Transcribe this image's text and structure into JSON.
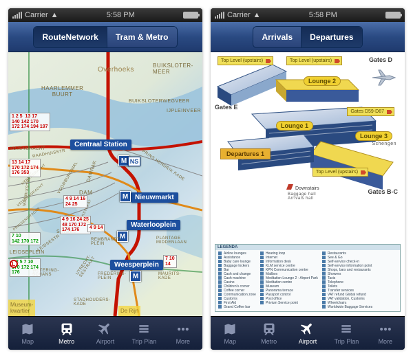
{
  "statusbar": {
    "carrier": "Carrier",
    "time": "5:58 PM",
    "wifi": "▲"
  },
  "left": {
    "nav": {
      "seg1": "RouteNetwork",
      "seg2": "Tram & Metro"
    },
    "tabs": {
      "map": "Map",
      "metro": "Metro",
      "airport": "Airport",
      "tripplan": "Trip Plan",
      "more": "More"
    },
    "stations": {
      "centraal": "Centraal Station",
      "nieuwmarkt": "Nieuwmarkt",
      "waterlooplein": "Waterlooplein",
      "weesperplein": "Weesperplein"
    },
    "metroBadge": "M",
    "areas": {
      "overhoeks": "Overhoeks",
      "haarlemmer": "HAARLEMMER\nBUURT",
      "buikslotermeer": "BUIKSLOTER-\nMEER",
      "buiksloterweg": "BUIKSLOTERWEGVEER",
      "ijpleinveer": "IJPLEINVEER",
      "damrak": "DAMRAK",
      "dam": "DAM",
      "voorburgwal": "VOORBURGWAL",
      "phk": "PRINS HENDRIK KADE",
      "singel": "SINGEL",
      "rembrandtpl": "REMBRANDT-\nPLEIN",
      "plantage": "PLANTAGE\nMIDDENLAAN",
      "frederiks": "FREDERIKS-\nPLEIN",
      "leidseplein": "LEIDSEPLEIN",
      "leidsestr": "LEIDSESTR",
      "weteringschans": "WETERING-\nSCHANS",
      "utrechtse": "UTRECHT-\nSESTRAAT",
      "mauritskade": "MAURITS-\nKADE",
      "stadhouderskade": "STADHOUDERS-\nKADE",
      "museumkwartier": "Museum-\nkwartier",
      "derijn": "De Rijn",
      "raadhuis": "RAADHUISSTR",
      "marnix": "MARNIXSTRAAT",
      "rozengr": "ROZENGRACHT",
      "kalverstr": "KALVERSTRAAT",
      "herengr": "HERENGRACHT",
      "keizersgr": "KEIZERSGRACHT",
      "prinsengr": "PRINSENGRACHT"
    },
    "lineBlocks": {
      "a": "1 2 5  13 17\n140 142 170\n172 174 194 197",
      "b": "13 14 17\n170 172 174\n176 353",
      "c": "7 10\n142 170 172",
      "d": "4 9 14 16\n24 25",
      "e": "4 9 16 24 25\n48 170 172\n174 176",
      "f": "1 2 5 7 10\n170 172 174\n176",
      "g": "7 10\n14",
      "h": "4 9 14"
    }
  },
  "right": {
    "nav": {
      "seg1": "Arrivals",
      "seg2": "Departures"
    },
    "tabs": {
      "map": "Map",
      "metro": "Metro",
      "airport": "Airport",
      "tripplan": "Trip Plan",
      "more": "More"
    },
    "labels": {
      "toplevel": "Top Level (upstairs)",
      "gatesD": "Gates D",
      "gatesE": "Gates E",
      "gatesBC": "Gates B-C",
      "gatesD59": "Gates D59-D87",
      "lounge1": "Lounge  1",
      "lounge2": "Lounge  2",
      "lounge3": "Lounge  3",
      "departures1": "Departures  1",
      "schengen": "Schengen",
      "downstairs": "Downstairs",
      "baggage": "Baggage hall\nArrivals hall"
    },
    "legend": {
      "title": "LEGENDA",
      "col1": [
        "Airline lounges",
        "Assistance",
        "Baby care lounge",
        "Baggage lockers",
        "Bar",
        "Cash and change",
        "Cash machine",
        "Casino",
        "Children's corner",
        "Coffee corner",
        "Communication zone",
        "Customs",
        "First Aid",
        "Grand Coffee bar"
      ],
      "col2": [
        "Hearing loop",
        "Internet",
        "Information desk",
        "KLM service centre",
        "KPN Communication centre",
        "Mailbox",
        "Meditation Lounge 2 - Airport Park",
        "Meditation centre",
        "Museum",
        "Panorama terrace",
        "Passport control",
        "Post office",
        "Privium Service point"
      ],
      "col3": [
        "Restaurants",
        "See & Go",
        "Self-service check-in",
        "Self-service information point",
        "Shops, bars and restaurants",
        "Showers",
        "Taxis",
        "Telephone",
        "Toilets",
        "Transfer services",
        "VAT refund Global refund",
        "VAT validation, Customs",
        "Wheelchairs",
        "Worldwide Baggage Services"
      ]
    }
  }
}
